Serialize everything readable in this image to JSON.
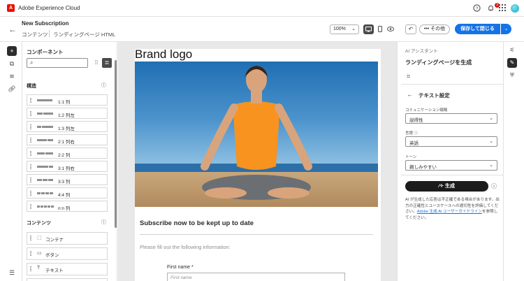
{
  "topbar": {
    "app_name": "Adobe Experience Cloud",
    "logo_letter": "A",
    "notification_count": "3"
  },
  "header": {
    "title": "New Subscription",
    "breadcrumb": [
      "コンテンツ",
      "ランディングページ HTML"
    ],
    "zoom": "100%",
    "more_label": "••• その他",
    "save_label": "保存して閉じる"
  },
  "components": {
    "title": "コンポーネント",
    "search_placeholder": "",
    "structure_title": "構造",
    "structure_items": [
      {
        "label": "1:1 列",
        "bars": [
          22
        ]
      },
      {
        "label": "1:2 列左",
        "bars": [
          8,
          14
        ]
      },
      {
        "label": "1:3 列左",
        "bars": [
          6,
          16
        ]
      },
      {
        "label": "2:1 列右",
        "bars": [
          14,
          8
        ]
      },
      {
        "label": "2:2 列",
        "bars": [
          11,
          11
        ]
      },
      {
        "label": "3:1 列右",
        "bars": [
          16,
          6
        ]
      },
      {
        "label": "3:3 列",
        "bars": [
          7,
          7,
          7
        ]
      },
      {
        "label": "4:4 列",
        "bars": [
          5,
          5,
          5,
          5
        ]
      },
      {
        "label": "n:n 列",
        "bars": [
          4,
          4,
          4,
          4,
          4
        ]
      }
    ],
    "content_title": "コンテンツ",
    "content_items": [
      {
        "label": "コンテナ",
        "icon": "⬚"
      },
      {
        "label": "ボタン",
        "icon": "▭"
      },
      {
        "label": "テキスト",
        "icon": "T"
      },
      {
        "label": "ディバイダー",
        "icon": "▬"
      }
    ]
  },
  "canvas": {
    "brand_logo": "Brand logo",
    "subscribe_heading": "Subscribe now to be kept up to date",
    "fill_out_text": "Please fill out the following information:",
    "first_name_label": "First name *",
    "first_name_placeholder": "First name"
  },
  "ai_panel": {
    "section_label": "AI アシスタント",
    "heading": "ランディングページを生成",
    "subheading": "テキスト設定",
    "communication_label": "コミュニケーション戦略",
    "communication_value": "説得性",
    "language_label": "言語 ⓘ",
    "language_value": "英語",
    "tone_label": "トーン",
    "tone_value": "親しみやすい",
    "generate_label": "生成",
    "disclaimer_prefix": "AI が生成した応答は不正確である場合があります。出力の正確性とユースケースへの適切性を評価してください。",
    "disclaimer_link": "Adobe 生成 AI ユーザーガイドライン",
    "disclaimer_suffix": "を参照してください。"
  }
}
